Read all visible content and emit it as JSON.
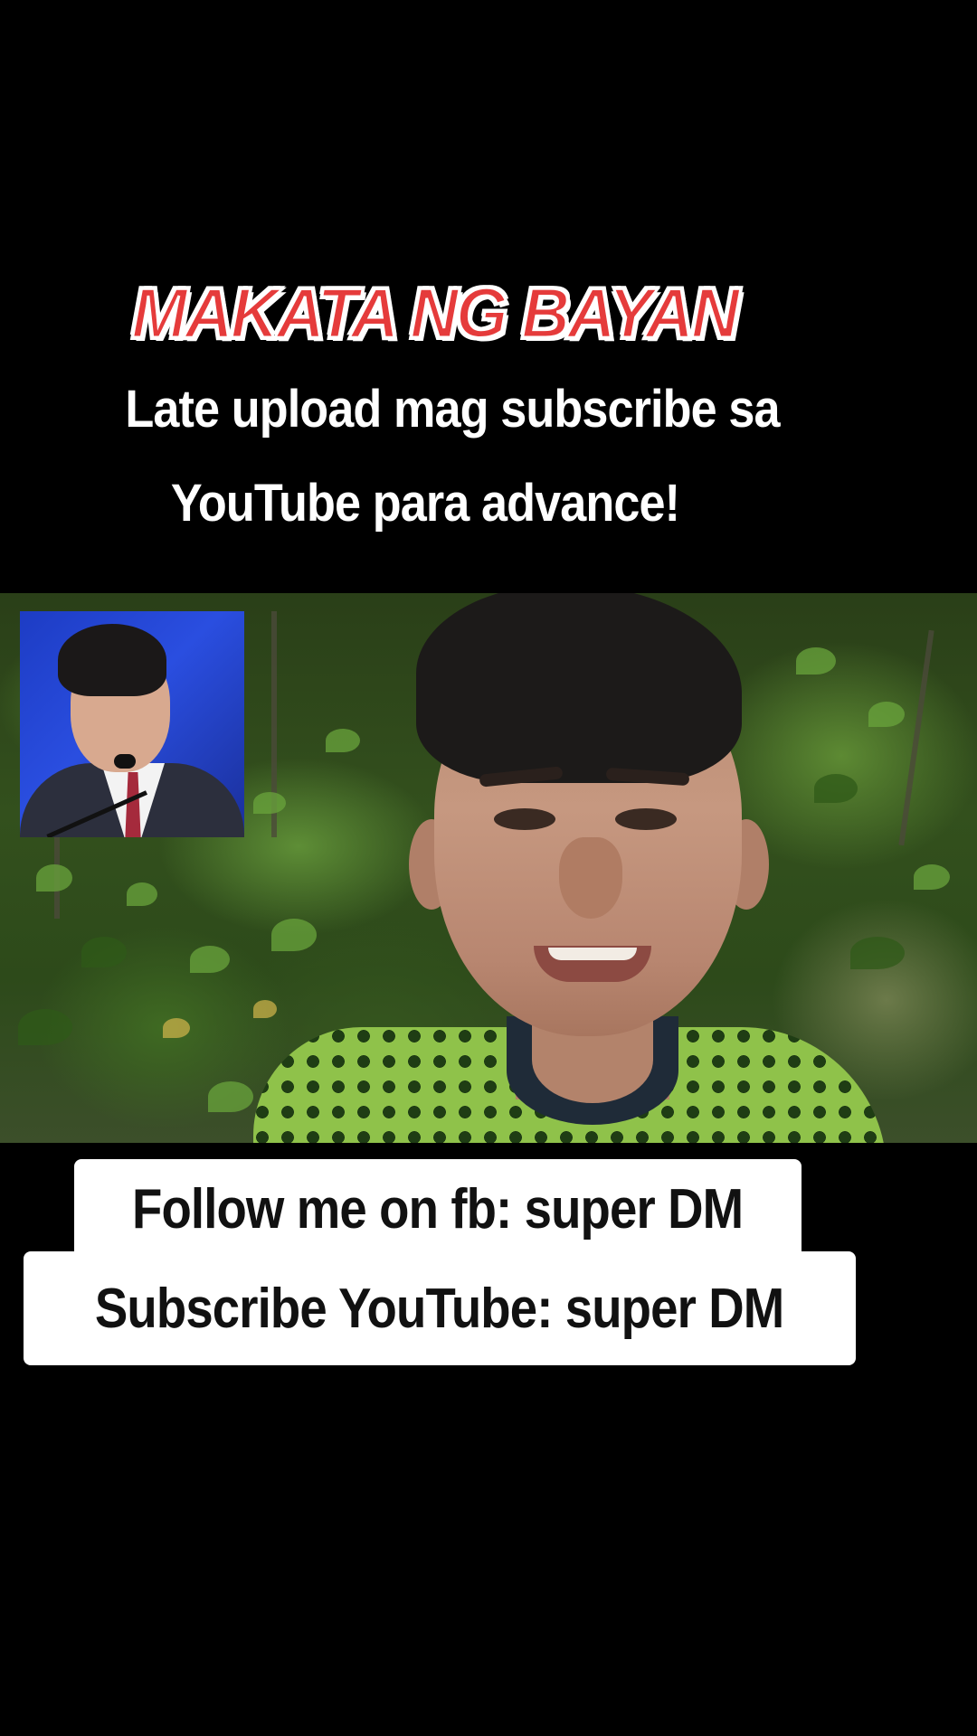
{
  "overlay": {
    "title": "MAKATA NG BAYAN",
    "subtitle_line1": "Late upload mag subscribe sa",
    "subtitle_line2": "YouTube para advance!"
  },
  "captions": {
    "line1": "Follow me on fb: super DM",
    "line2": "Subscribe YouTube: super DM"
  },
  "colors": {
    "background": "#000000",
    "title_fill": "#e53b3b",
    "title_outline": "#ffffff",
    "caption_bg": "#ffffff",
    "caption_text": "#111111"
  }
}
